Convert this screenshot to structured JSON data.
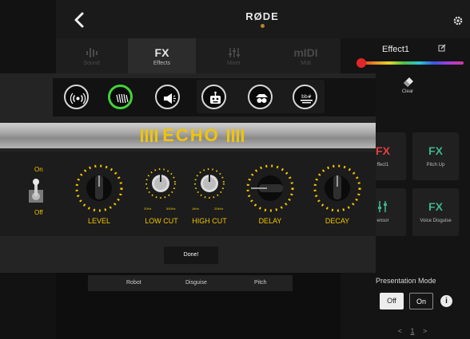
{
  "header": {
    "brand": "RØDE",
    "back_icon": "chevron-left-icon",
    "settings_icon": "gear-icon"
  },
  "nav": {
    "tabs": [
      {
        "label": "Sound",
        "icon": "waveform-icon"
      },
      {
        "label": "Effects",
        "icon_text": "FX"
      },
      {
        "label": "Mixer",
        "icon": "mixer-icon"
      },
      {
        "label": "Midi",
        "icon_text": "mIDI"
      }
    ],
    "active": "Effects"
  },
  "right_panel": {
    "effect_name": "Effect1",
    "edit_icon": "edit-icon",
    "color_slider_value": 0.0,
    "clear_label": "Clear",
    "tiles": [
      {
        "icon_text": "FX",
        "label": "ffect1"
      },
      {
        "icon_text": "FX",
        "label": "Pitch Up"
      },
      {
        "icon_text": "",
        "label": "ensor"
      },
      {
        "icon_text": "FX",
        "label": "Voice Disguise"
      }
    ],
    "presentation_mode_label": "Presentation Mode",
    "off_label": "Off",
    "on_label": "On",
    "info_icon": "i",
    "pager_prev": "<",
    "pager_page": "1",
    "pager_next": ">"
  },
  "bottom_strip": [
    "Robot",
    "Disguise",
    "Pitch"
  ],
  "overlay": {
    "effect_icons": [
      "radio-waves-icon",
      "echo-icon",
      "megaphone-icon",
      "robot-icon",
      "disguise-icon",
      "pitch-icon"
    ],
    "selected_icon": "echo-icon",
    "title": "ECHO",
    "toggle": {
      "on_label": "On",
      "off_label": "Off",
      "state": "on"
    },
    "controls": [
      {
        "label": "LEVEL",
        "min_label": "",
        "max_label": ""
      },
      {
        "label": "LOW CUT",
        "min_label": "20Hz",
        "max_label": "500Hz"
      },
      {
        "label": "HIGH CUT",
        "min_label": "1kHz",
        "max_label": "20kHz"
      },
      {
        "label": "DELAY",
        "min_label": "",
        "max_label": ""
      },
      {
        "label": "DECAY",
        "min_label": "",
        "max_label": ""
      }
    ],
    "done_label": "Done!"
  },
  "colors": {
    "accent_yellow": "#f2c400",
    "selected_green": "#44d13a",
    "fx_green": "#3fb38f",
    "fx_red": "#e24040"
  }
}
